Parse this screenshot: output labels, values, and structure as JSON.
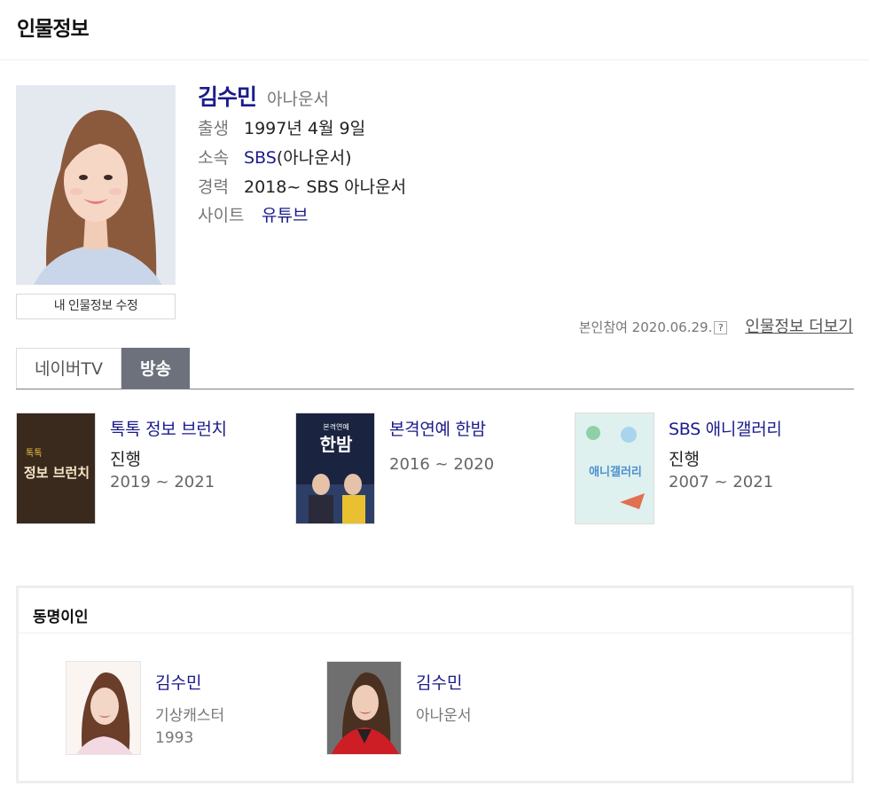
{
  "header": {
    "title": "인물정보"
  },
  "profile": {
    "name": "김수민",
    "job": "아나운서",
    "rows": [
      {
        "label": "출생",
        "value": "1997년 4월 9일"
      },
      {
        "label": "소속",
        "link": "SBS",
        "value": "(아나운서)"
      },
      {
        "label": "경력",
        "value": "2018~ SBS 아나운서"
      },
      {
        "label": "사이트",
        "link": "유튜브"
      }
    ],
    "edit_label": "내 인물정보 수정"
  },
  "meta": {
    "participation": "본인참여 2020.06.29.",
    "help_icon": "?",
    "more_label": "인물정보 더보기"
  },
  "tabs": [
    {
      "label": "네이버TV",
      "active": false
    },
    {
      "label": "방송",
      "active": true
    }
  ],
  "shows": [
    {
      "title": "톡톡 정보 브런치",
      "role": "진행",
      "years": "2019 ~ 2021",
      "poster_text": "정보 브런치",
      "poster_badge": "톡톡"
    },
    {
      "title": "본격연예 한밤",
      "role": "",
      "years": "2016 ~ 2020",
      "poster_text": "한밤",
      "poster_badge": "본격연예"
    },
    {
      "title": "SBS 애니갤러리",
      "role": "진행",
      "years": "2007 ~ 2021",
      "poster_text": "애니갤러리"
    }
  ],
  "namesake": {
    "title": "동명이인",
    "people": [
      {
        "name": "김수민",
        "job": "기상캐스터",
        "year": "1993"
      },
      {
        "name": "김수민",
        "job": "아나운서",
        "year": ""
      }
    ]
  },
  "colors": {
    "link": "#1b1b8c",
    "active_tab": "#6c717c",
    "muted": "#777777"
  }
}
